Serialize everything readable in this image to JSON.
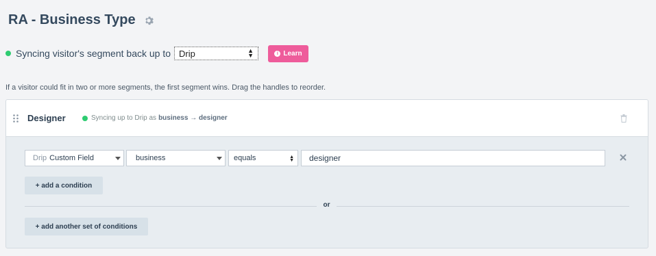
{
  "page": {
    "title": "RA - Business Type"
  },
  "sync": {
    "prefix": "Syncing visitor's segment back up to",
    "provider_selected": "Drip",
    "learn_label": "Learn",
    "status_color": "#2ecc71"
  },
  "hint": "If a visitor could fit in two or more segments, the first segment wins. Drag the handles to reorder.",
  "segment": {
    "name": "Designer",
    "sync_text": "Syncing up to Drip as",
    "sync_mapping": "business → designer",
    "condition": {
      "source_prefix": "Drip",
      "source": "Custom Field",
      "field": "business",
      "operator": "equals",
      "value": "designer"
    },
    "add_condition_label": "add a condition",
    "or_label": "or",
    "add_set_label": "add another set of conditions"
  },
  "colors": {
    "accent_pink": "#ee5c9b",
    "success_green": "#2ecc71"
  }
}
